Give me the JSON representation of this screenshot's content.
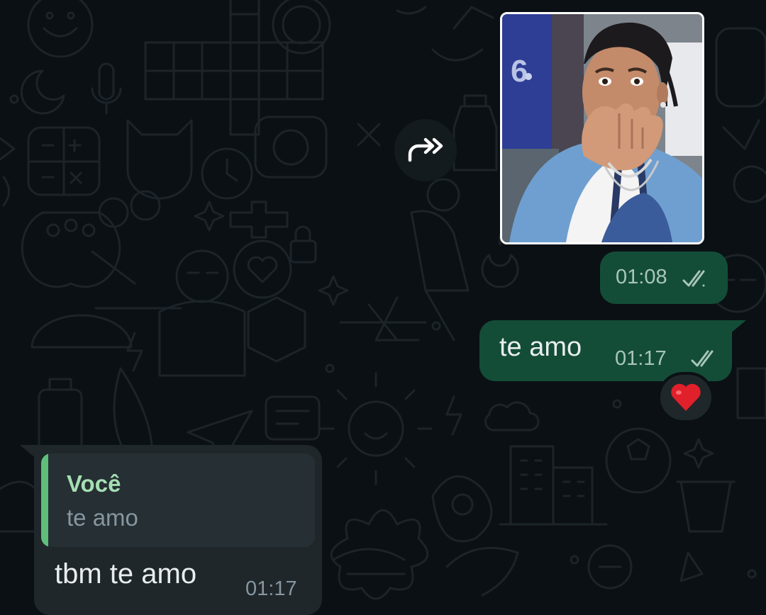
{
  "chat": {
    "messages": [
      {
        "direction": "outgoing",
        "type": "sticker",
        "sticker_icon": "sticker-image",
        "time": "01:08",
        "status_icon": "double-check-icon"
      },
      {
        "direction": "outgoing",
        "type": "text",
        "text": "te amo",
        "time": "01:17",
        "status_icon": "double-check-icon",
        "reaction": "❤️"
      },
      {
        "direction": "incoming",
        "type": "reply",
        "quote_author": "Você",
        "quote_text": "te amo",
        "text": "tbm te amo",
        "time": "01:17"
      }
    ],
    "forward_icon": "forward-icon"
  },
  "colors": {
    "background": "#0b1014",
    "outgoing_bubble": "#144d37",
    "incoming_bubble": "#1f272a",
    "quote_accent": "#5fbf7a",
    "text": "#e9edef"
  }
}
